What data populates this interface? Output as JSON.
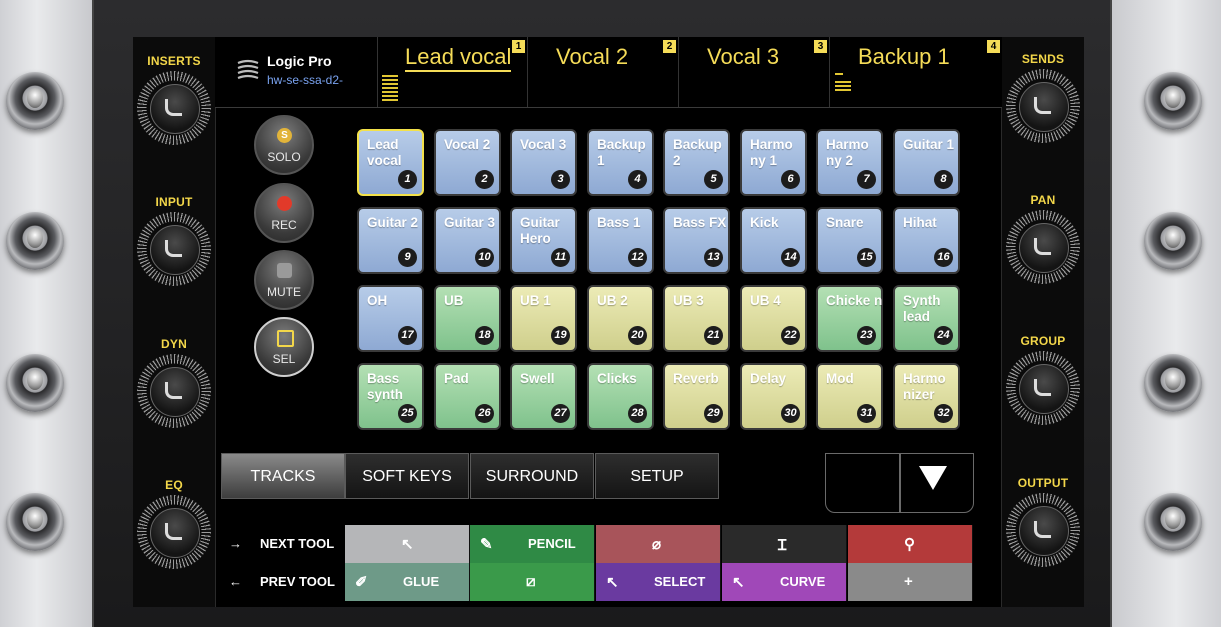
{
  "header": {
    "app_title": "Logic Pro",
    "device": "hw-se-ssa-d2-",
    "channels": [
      {
        "name": "Lead vocal",
        "num": "1"
      },
      {
        "name": "Vocal 2",
        "num": "2"
      },
      {
        "name": "Vocal 3",
        "num": "3"
      },
      {
        "name": "Backup 1",
        "num": "4"
      }
    ]
  },
  "left_knobs": [
    "INSERTS",
    "INPUT",
    "DYN",
    "EQ"
  ],
  "right_knobs": [
    "SENDS",
    "PAN",
    "GROUP",
    "OUTPUT"
  ],
  "controls": [
    {
      "label": "SOLO",
      "icon": "S"
    },
    {
      "label": "REC"
    },
    {
      "label": "MUTE"
    },
    {
      "label": "SEL"
    }
  ],
  "tracks": [
    {
      "label": "Lead vocal",
      "num": "1",
      "color": "blue"
    },
    {
      "label": "Vocal 2",
      "num": "2",
      "color": "blue"
    },
    {
      "label": "Vocal 3",
      "num": "3",
      "color": "blue"
    },
    {
      "label": "Backup 1",
      "num": "4",
      "color": "blue"
    },
    {
      "label": "Backup 2",
      "num": "5",
      "color": "blue"
    },
    {
      "label": "Harmo ny 1",
      "num": "6",
      "color": "blue"
    },
    {
      "label": "Harmo ny 2",
      "num": "7",
      "color": "blue"
    },
    {
      "label": "Guitar 1",
      "num": "8",
      "color": "blue"
    },
    {
      "label": "Guitar 2",
      "num": "9",
      "color": "blue"
    },
    {
      "label": "Guitar 3",
      "num": "10",
      "color": "blue"
    },
    {
      "label": "Guitar Hero",
      "num": "11",
      "color": "blue"
    },
    {
      "label": "Bass 1",
      "num": "12",
      "color": "blue"
    },
    {
      "label": "Bass FX",
      "num": "13",
      "color": "blue"
    },
    {
      "label": "Kick",
      "num": "14",
      "color": "blue"
    },
    {
      "label": "Snare",
      "num": "15",
      "color": "blue"
    },
    {
      "label": "Hihat",
      "num": "16",
      "color": "blue"
    },
    {
      "label": "OH",
      "num": "17",
      "color": "blue"
    },
    {
      "label": "UB",
      "num": "18",
      "color": "green"
    },
    {
      "label": "UB 1",
      "num": "19",
      "color": "yellow"
    },
    {
      "label": "UB 2",
      "num": "20",
      "color": "yellow"
    },
    {
      "label": "UB 3",
      "num": "21",
      "color": "yellow"
    },
    {
      "label": "UB 4",
      "num": "22",
      "color": "yellow"
    },
    {
      "label": "Chicke n",
      "num": "23",
      "color": "green"
    },
    {
      "label": "Synth lead",
      "num": "24",
      "color": "green"
    },
    {
      "label": "Bass synth",
      "num": "25",
      "color": "green"
    },
    {
      "label": "Pad",
      "num": "26",
      "color": "green"
    },
    {
      "label": "Swell",
      "num": "27",
      "color": "green"
    },
    {
      "label": "Clicks",
      "num": "28",
      "color": "green"
    },
    {
      "label": "Reverb",
      "num": "29",
      "color": "yellow"
    },
    {
      "label": "Delay",
      "num": "30",
      "color": "yellow"
    },
    {
      "label": "Mod",
      "num": "31",
      "color": "yellow"
    },
    {
      "label": "Harmo nizer",
      "num": "32",
      "color": "yellow"
    }
  ],
  "tabs": [
    "TRACKS",
    "SOFT KEYS",
    "SURROUND",
    "SETUP"
  ],
  "tools": {
    "next_label": "NEXT TOOL",
    "prev_label": "PREV TOOL",
    "next_arrow": "→",
    "prev_arrow": "←",
    "row1": [
      {
        "icon": "pointer-icon",
        "glyph": "↖",
        "text": "",
        "bg": "#b5b6b8"
      },
      {
        "icon": "pencil-icon",
        "glyph": "✎",
        "text": "PENCIL",
        "bg": "#2f8a45"
      },
      {
        "icon": "eraser-icon",
        "glyph": "⌀",
        "text": "",
        "bg": "#a8545a"
      },
      {
        "icon": "text-cursor-icon",
        "glyph": "Ɪ",
        "text": "",
        "bg": "#2a2a2a"
      },
      {
        "icon": "solo-tool-icon",
        "glyph": "⚲",
        "text": "",
        "bg": "#b43a3a"
      }
    ],
    "row2": [
      {
        "icon": "glue-icon",
        "glyph": "✐",
        "text": "GLUE",
        "bg": "#6e9a88"
      },
      {
        "icon": "fade-icon",
        "glyph": "⧄",
        "text": "",
        "bg": "#3a9a4a"
      },
      {
        "icon": "select-pointer-icon",
        "glyph": "↖",
        "text": "SELECT",
        "bg": "#6a3aa0"
      },
      {
        "icon": "curve-pointer-icon",
        "glyph": "↖",
        "text": "CURVE",
        "bg": "#a048b8"
      },
      {
        "icon": "crosshair-icon",
        "glyph": "+",
        "text": "",
        "bg": "#8a8a8a"
      }
    ]
  }
}
